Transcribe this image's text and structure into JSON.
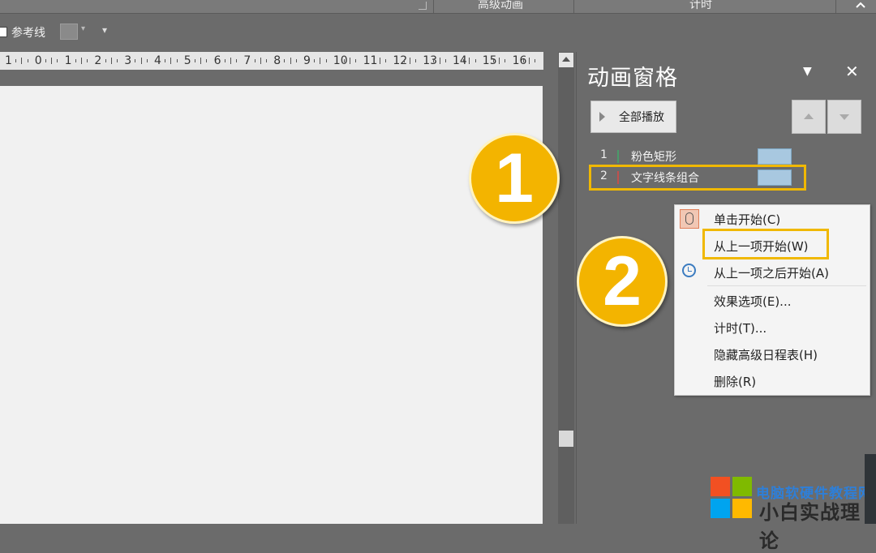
{
  "ribbon": {
    "groups": [
      {
        "label": "高级动画"
      },
      {
        "label": "计时"
      }
    ],
    "collapse_icon": "chevron-up-icon"
  },
  "toolbar": {
    "guides_checkbox_label": "参考线",
    "guides_checked": false
  },
  "ruler": {
    "ticks": [
      "1",
      "0",
      "1",
      "2",
      "3",
      "4",
      "5",
      "6",
      "7",
      "8",
      "9",
      "10",
      "11",
      "12",
      "13",
      "14",
      "15",
      "16"
    ]
  },
  "animation_pane": {
    "title": "动画窗格",
    "play_all_label": "全部播放",
    "items": [
      {
        "index": "1",
        "name": "粉色矩形"
      },
      {
        "index": "2",
        "name": "文字线条组合"
      }
    ]
  },
  "context_menu": {
    "items": [
      {
        "label": "单击开始(C)",
        "icon": "mouse-click-icon"
      },
      {
        "label": "从上一项开始(W)",
        "icon": ""
      },
      {
        "label": "从上一项之后开始(A)",
        "icon": "clock-icon"
      },
      {
        "label": "效果选项(E)...",
        "icon": ""
      },
      {
        "label": "计时(T)...",
        "icon": ""
      },
      {
        "label": "隐藏高级日程表(H)",
        "icon": ""
      },
      {
        "label": "删除(R)",
        "icon": ""
      }
    ]
  },
  "callouts": [
    "1",
    "2"
  ],
  "watermark": {
    "line1": "电脑软硬件教程网",
    "line2": "小白实战理论"
  },
  "colors": {
    "accent_highlight": "#f0b800",
    "callout_fill": "#f3b400",
    "pane_bg": "#6b6b6b",
    "menu_bg": "#f4f4f4",
    "timeline_bar": "#a8c8e0"
  }
}
